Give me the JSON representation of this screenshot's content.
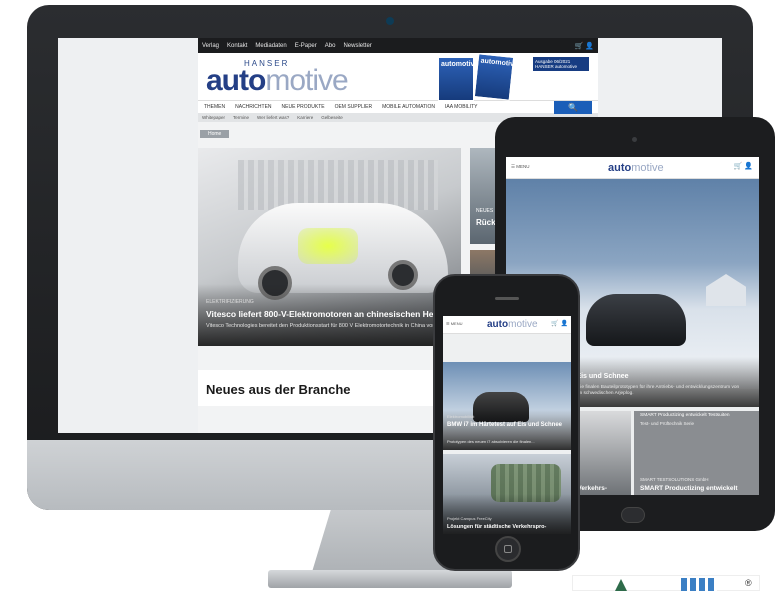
{
  "desktop": {
    "topbar": [
      "Verlag",
      "Kontakt",
      "Mediadaten",
      "E-Paper",
      "Abo",
      "Newsletter"
    ],
    "topbar_icons": "🛒 👤",
    "brand": {
      "hanser": "HANSER",
      "logo_a": "auto",
      "logo_b": "motive"
    },
    "magazine": {
      "cover_a": "automotive",
      "cover_b": "automotive",
      "issue": "Ausgabe 06/2021 HANSER automotive"
    },
    "nav": [
      "THEMEN",
      "NACHRICHTEN",
      "NEUE PRODUKTE",
      "OEM SUPPLIER",
      "MOBILE AUTOMATION",
      "IAA MOBILITY"
    ],
    "search_icon": "🔍",
    "subnav": [
      "Whitepaper",
      "Termine",
      "Wer liefert was?",
      "Karriere",
      "Gelbeseite"
    ],
    "breadcrumb": "Home",
    "hero": {
      "tag": "ELEKTRIFIZIERUNG",
      "title": "Vitesco liefert 800-V-Elektromotoren an chinesischen Hersteller",
      "teaser": "Vitesco Technologies bereitet den Produktionsstart für 800 V Elektromotortechnik in China vor."
    },
    "side_card": {
      "label": "NEUES",
      "title": "Rück 2021"
    },
    "news_heading": "Neues aus der Branche"
  },
  "tablet": {
    "menu": "☰ MENU",
    "brand": {
      "logo_a": "auto",
      "logo_b": "motive"
    },
    "icons": "🛒 👤",
    "hero": {
      "title": "auf Eis und Schnee",
      "teaser": "rieren die finalen Bauteilprototypen für ihre Antriebs- und entwicklungszentrum von BMW im schwedischen Arjeplog."
    },
    "right_card": {
      "heading": "SMART Productizing entwickelt Testsuiten",
      "subheading": "Test- und Prüftechnik Serie",
      "sub": "SMART TESTSOLUTIONS GmbH",
      "title": "SMART Productizing entwickelt"
    },
    "left_card": {
      "title": "e Verkehrs-"
    }
  },
  "phone": {
    "menu": "☰ MENU",
    "brand": {
      "logo_a": "auto",
      "logo_b": "motive"
    },
    "icons": "🛒 👤",
    "hero": {
      "tag": "Elektromobilität",
      "title": "BMW i7 im Härtetest auf Eis und Schnee",
      "teaser": "Prototypen des neuen i7 absolvieren die finalen..."
    },
    "hero2": {
      "tag": "Projekt Campus FreeCity",
      "title": "Lösungen für städtische Verkehrspro-"
    }
  },
  "badge": {
    "mark": "®"
  }
}
